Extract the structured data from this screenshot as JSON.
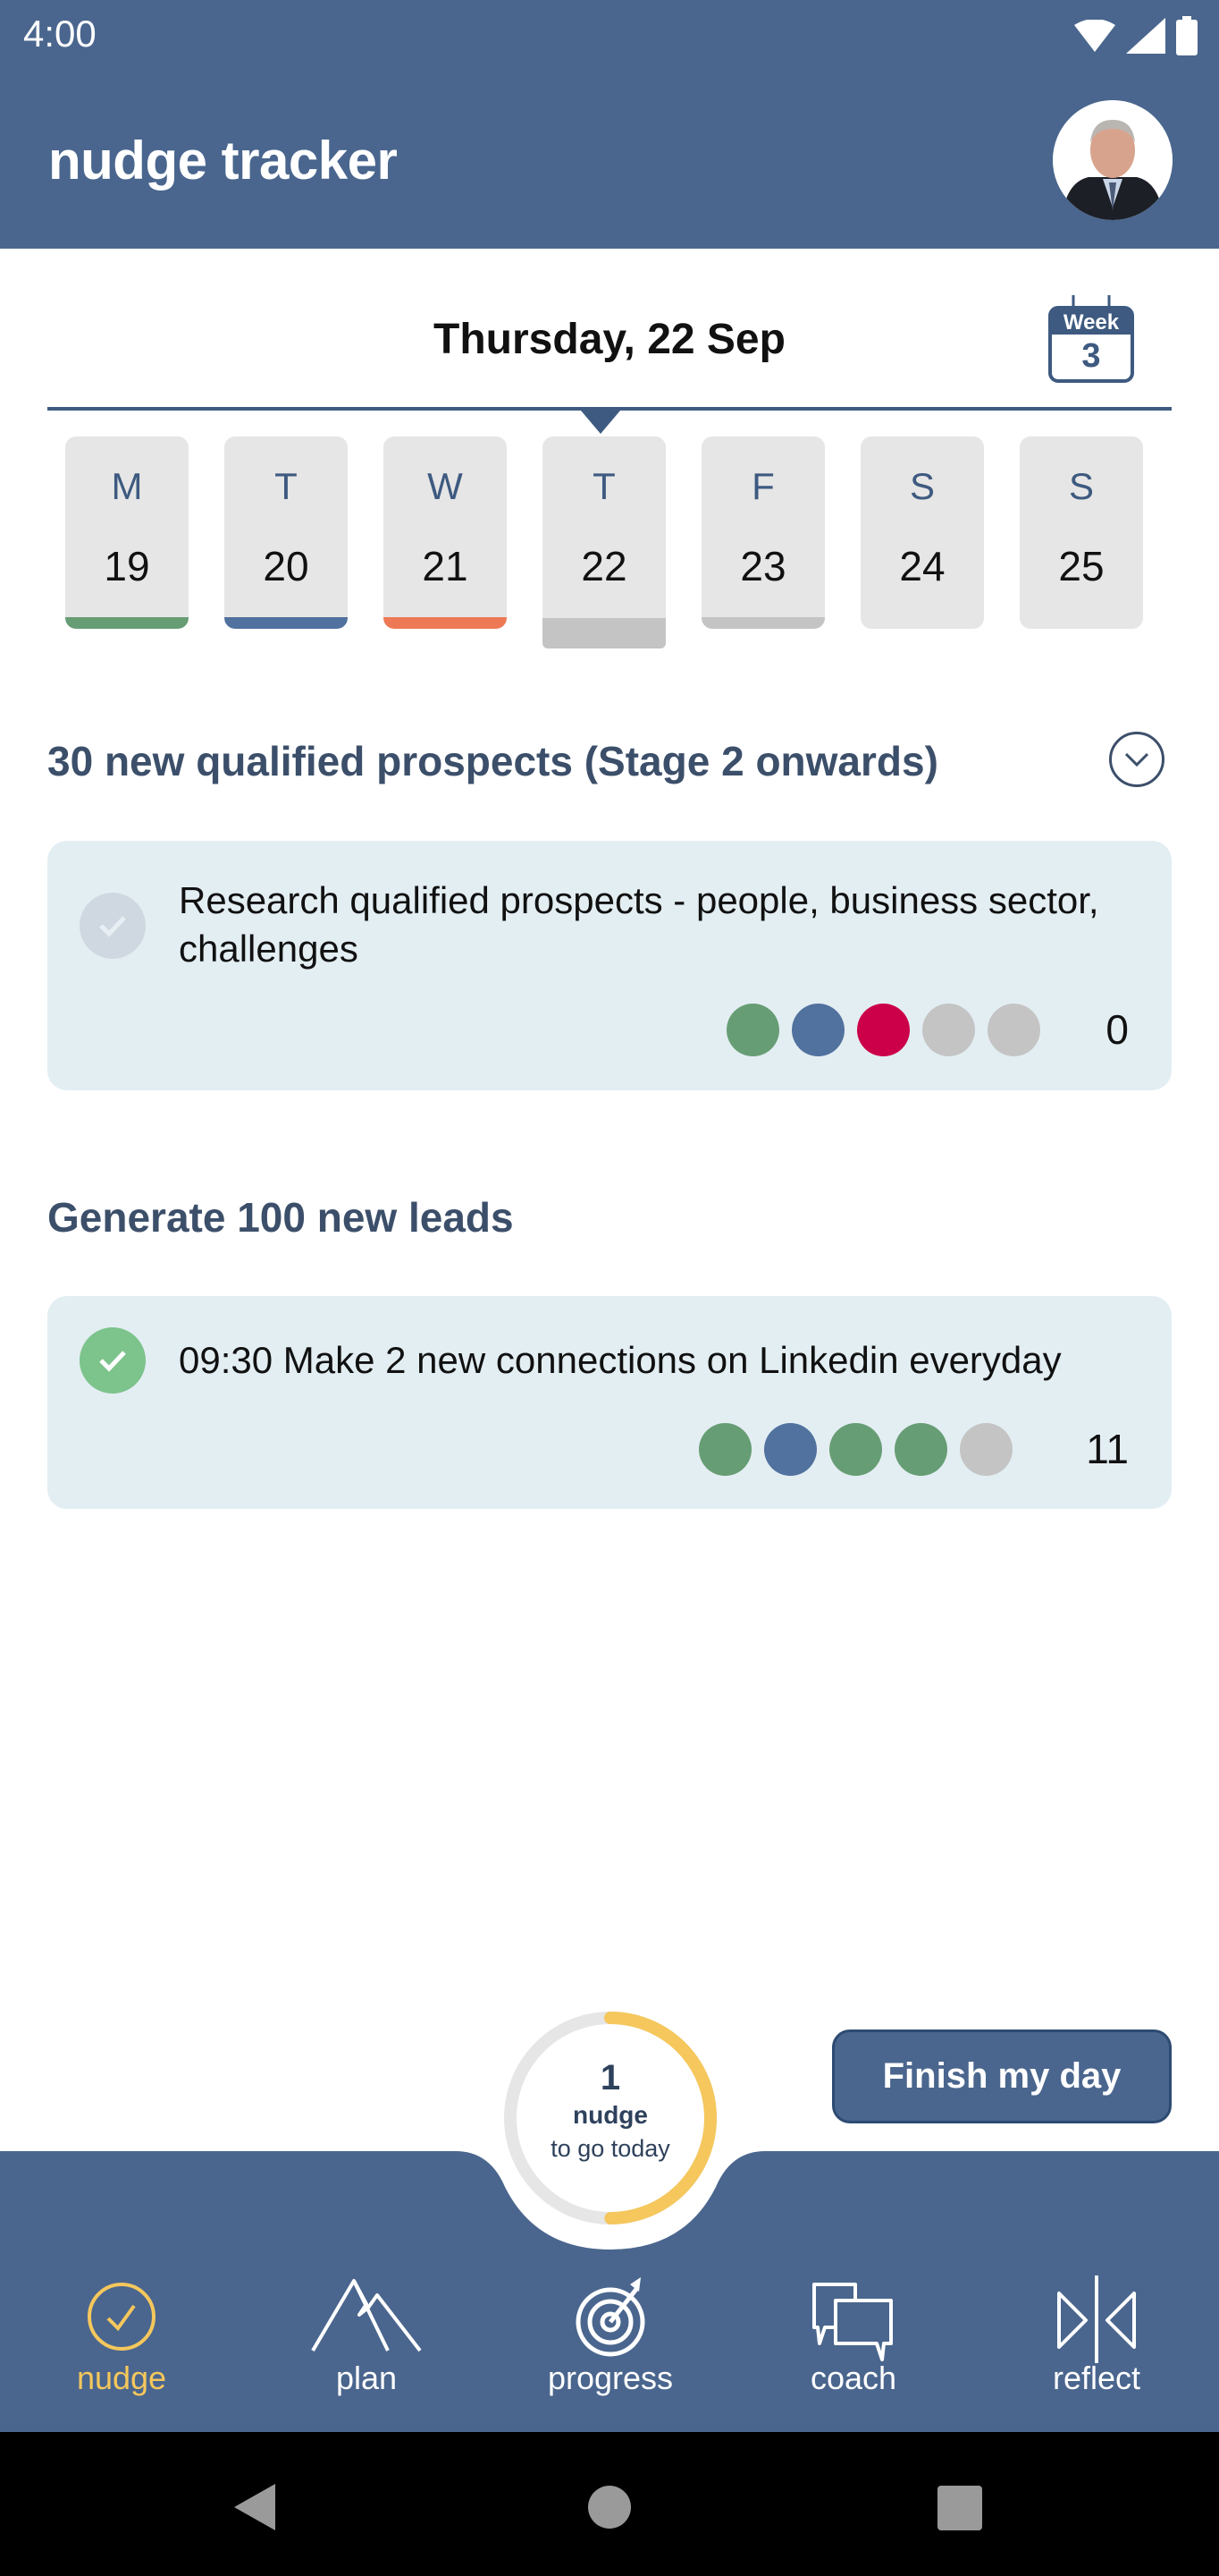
{
  "status_bar": {
    "time": "4:00",
    "icons": [
      "wifi-icon",
      "signal-icon",
      "battery-icon"
    ]
  },
  "header": {
    "title": "nudge tracker",
    "avatar": "user-avatar"
  },
  "date_selector": {
    "title": "Thursday, 22 Sep",
    "week_badge": {
      "label": "Week",
      "number": "3"
    },
    "days": [
      {
        "letter": "M",
        "date": "19",
        "status_color": "#679d74",
        "selected": false
      },
      {
        "letter": "T",
        "date": "20",
        "status_color": "#51719e",
        "selected": false
      },
      {
        "letter": "W",
        "date": "21",
        "status_color": "#ee7a55",
        "selected": false
      },
      {
        "letter": "T",
        "date": "22",
        "status_color": "#c4c4c4",
        "selected": true
      },
      {
        "letter": "F",
        "date": "23",
        "status_color": "#c4c4c4",
        "selected": false
      },
      {
        "letter": "S",
        "date": "24",
        "status_color": null,
        "selected": false
      },
      {
        "letter": "S",
        "date": "25",
        "status_color": null,
        "selected": false
      }
    ]
  },
  "goals": [
    {
      "heading": "30 new qualified prospects (Stage 2 onwards)",
      "collapse_icon": "chevron-down-circle-icon",
      "nudges": [
        {
          "text": "Research qualified prospects - people, business sector, challenges",
          "completed": false,
          "history_dots": [
            "#679d74",
            "#51719e",
            "#cc0048",
            "#c4c4c4",
            "#c4c4c4"
          ],
          "count": "0"
        }
      ]
    },
    {
      "heading": "Generate 100 new leads",
      "nudges": [
        {
          "text": "09:30 Make 2 new connections on Linkedin everyday",
          "completed": true,
          "history_dots": [
            "#679d74",
            "#51719e",
            "#679d74",
            "#679d74",
            "#c4c4c4"
          ],
          "count": "11"
        }
      ]
    }
  ],
  "progress_ring": {
    "number": "1",
    "line1": "nudge",
    "line2": "to go today",
    "fraction_complete": 0.5
  },
  "finish_button": {
    "label": "Finish my day"
  },
  "bottom_nav": {
    "items": [
      {
        "label": "nudge",
        "icon": "check-circle-icon",
        "active": true
      },
      {
        "label": "plan",
        "icon": "mountain-icon",
        "active": false
      },
      {
        "label": "progress",
        "icon": "target-icon",
        "active": false
      },
      {
        "label": "coach",
        "icon": "chat-bubbles-icon",
        "active": false
      },
      {
        "label": "reflect",
        "icon": "mirror-icon",
        "active": false
      }
    ]
  },
  "colors": {
    "primary": "#4a668e",
    "accent": "#f5c75c",
    "card_bg": "#e3eef3",
    "heading": "#3c4f6a",
    "done_green": "#7cc38c"
  }
}
